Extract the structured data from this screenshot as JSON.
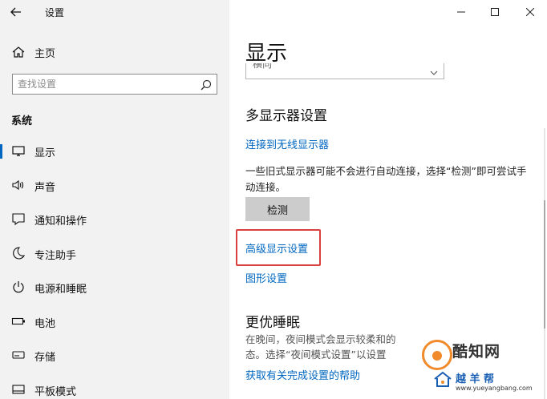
{
  "window": {
    "title": "设置"
  },
  "sidebar": {
    "home_label": "主页",
    "search_placeholder": "查找设置",
    "section_title": "系统",
    "items": [
      {
        "label": "显示",
        "icon": "monitor-icon",
        "active": true
      },
      {
        "label": "声音",
        "icon": "speaker-icon",
        "active": false
      },
      {
        "label": "通知和操作",
        "icon": "notification-icon",
        "active": false
      },
      {
        "label": "专注助手",
        "icon": "moon-icon",
        "active": false
      },
      {
        "label": "电源和睡眠",
        "icon": "power-icon",
        "active": false
      },
      {
        "label": "电池",
        "icon": "battery-icon",
        "active": false
      },
      {
        "label": "存储",
        "icon": "storage-icon",
        "active": false
      },
      {
        "label": "平板模式",
        "icon": "tablet-icon",
        "active": false
      }
    ]
  },
  "main": {
    "page_title": "显示",
    "dropdown_value": "横向",
    "multi_display": {
      "heading": "多显示器设置",
      "connect_link": "连接到无线显示器",
      "description": "一些旧式显示器可能不会进行自动连接，选择“检测”即可尝试手动连接。",
      "detect_button": "检测",
      "advanced_link": "高级显示设置",
      "graphics_link": "图形设置"
    },
    "sleep": {
      "heading": "更优睡眠",
      "description_line1": "在晚间，夜间模式会显示较柔和的",
      "description_line2": "态。选择“夜间模式设置”以设置",
      "help_link": "获取有关完成设置的帮助"
    }
  },
  "watermark": {
    "brand": "酷知网",
    "sub": "越 羊 帮",
    "url": "www.yueyangbang.com"
  },
  "colors": {
    "accent": "#0067c0",
    "sidebar_bg": "#f2f2f2",
    "highlight": "#d9413f"
  }
}
